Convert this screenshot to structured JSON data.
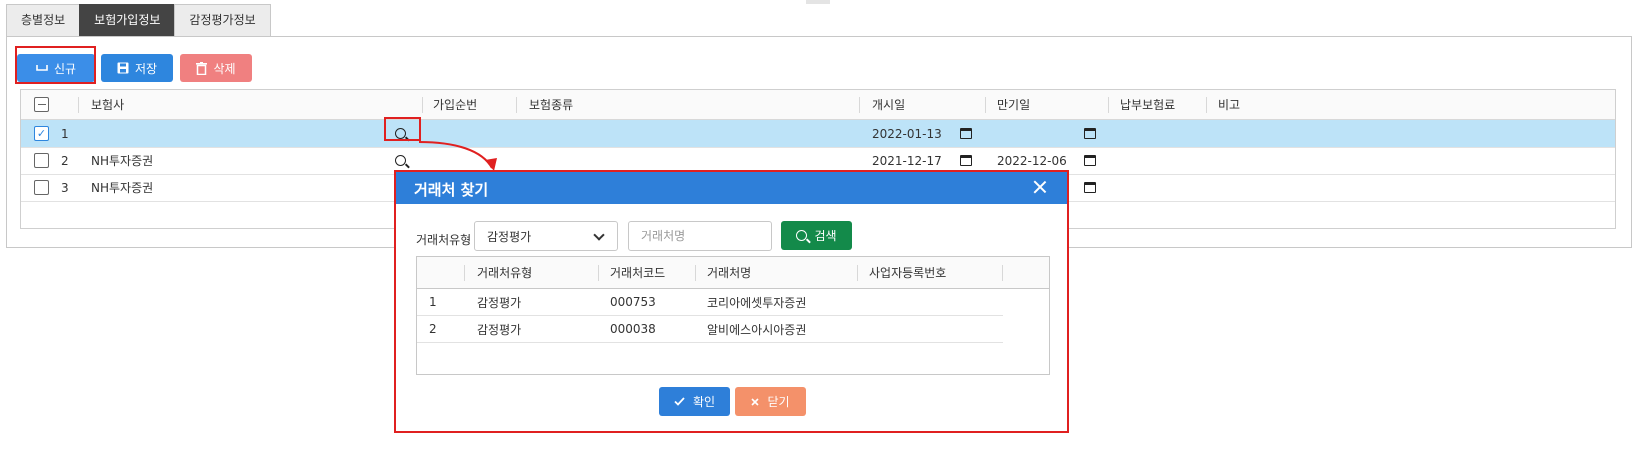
{
  "tabs": [
    {
      "label": "층별정보",
      "active": false
    },
    {
      "label": "보험가입정보",
      "active": true
    },
    {
      "label": "감정평가정보",
      "active": false
    }
  ],
  "toolbar": {
    "new_label": "신규",
    "save_label": "저장",
    "delete_label": "삭제"
  },
  "colors": {
    "accent": "#2e7fd9",
    "search_button": "#138a4a",
    "delete_button": "#f08080",
    "close_button": "#f4916a",
    "selected_row": "#bde3f8",
    "highlight": "#e02020"
  },
  "grid": {
    "columns": [
      "보험사",
      "가입순번",
      "보험종류",
      "개시일",
      "만기일",
      "납부보험료",
      "비고"
    ],
    "rows": [
      {
        "no": "1",
        "insurer": "",
        "start_date": "2022-01-13",
        "end_date": "",
        "checked": true
      },
      {
        "no": "2",
        "insurer": "NH투자증권",
        "start_date": "2021-12-17",
        "end_date": "2022-12-06",
        "checked": false
      },
      {
        "no": "3",
        "insurer": "NH투자증권",
        "start_date": "",
        "end_date": "",
        "checked": false
      }
    ]
  },
  "modal": {
    "title": "거래처 찾기",
    "type_label": "거래처유형",
    "type_value": "감정평가",
    "name_placeholder": "거래처명",
    "search_label": "검색",
    "columns": [
      "거래처유형",
      "거래처코드",
      "거래처명",
      "사업자등록번호"
    ],
    "rows": [
      {
        "no": "1",
        "type": "감정평가",
        "code": "000753",
        "name": "코리아에셋투자증권",
        "biz_no": ""
      },
      {
        "no": "2",
        "type": "감정평가",
        "code": "000038",
        "name": "알비에스아시아증권",
        "biz_no": ""
      }
    ],
    "ok_label": "확인",
    "close_label": "닫기"
  }
}
